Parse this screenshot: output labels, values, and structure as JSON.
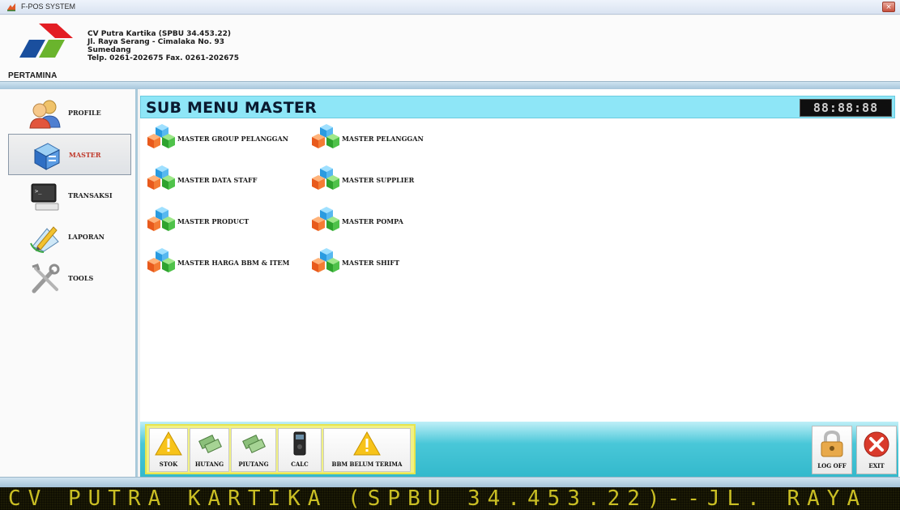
{
  "window": {
    "title": "F-POS SYSTEM",
    "close_symbol": "×"
  },
  "header": {
    "logo_text": "PERTAMINA",
    "company_lines": [
      "CV Putra Kartika (SPBU 34.453.22)",
      "Jl. Raya Serang - Cimalaka No. 93",
      "Sumedang",
      "Telp. 0261-202675  Fax. 0261-202675"
    ]
  },
  "sidebar": {
    "items": [
      {
        "label": "PROFILE",
        "icon": "users-icon",
        "active": false
      },
      {
        "label": "MASTER",
        "icon": "database-icon",
        "active": true
      },
      {
        "label": "TRANSAKSI",
        "icon": "terminal-icon",
        "active": false
      },
      {
        "label": "LAPORAN",
        "icon": "report-pencil-icon",
        "active": false
      },
      {
        "label": "TOOLS",
        "icon": "tools-icon",
        "active": false
      }
    ]
  },
  "main": {
    "title": "SUB MENU MASTER",
    "clock": "88:88:88",
    "menu_items": [
      {
        "label": "MASTER GROUP PELANGGAN",
        "icon": "cubes-icon"
      },
      {
        "label": "MASTER PELANGGAN",
        "icon": "cubes-icon"
      },
      {
        "label": "MASTER DATA STAFF",
        "icon": "cubes-icon"
      },
      {
        "label": "MASTER SUPPLIER",
        "icon": "cubes-icon"
      },
      {
        "label": "MASTER PRODUCT",
        "icon": "cubes-icon"
      },
      {
        "label": "MASTER POMPA",
        "icon": "cubes-icon"
      },
      {
        "label": "MASTER HARGA BBM & ITEM",
        "icon": "cubes-icon"
      },
      {
        "label": "MASTER SHIFT",
        "icon": "cubes-icon"
      }
    ]
  },
  "toolbar": {
    "tools": [
      {
        "label": "STOK",
        "icon": "warning-icon"
      },
      {
        "label": "HUTANG",
        "icon": "money-icon"
      },
      {
        "label": "PIUTANG",
        "icon": "money-icon"
      },
      {
        "label": "CALC",
        "icon": "calculator-icon"
      },
      {
        "label": "BBM BELUM TERIMA",
        "icon": "warning-icon"
      }
    ],
    "log_off_label": "LOG OFF",
    "exit_label": "EXIT"
  },
  "ticker": {
    "text": "CV PUTRA KARTIKA (SPBU 34.453.22)--JL. RAYA"
  },
  "colors": {
    "submenu_header": "#8ee6f7",
    "toolbar_band": "#33b9cc",
    "tool_group_bg": "#f1f184",
    "ticker_text": "#c9be24"
  }
}
